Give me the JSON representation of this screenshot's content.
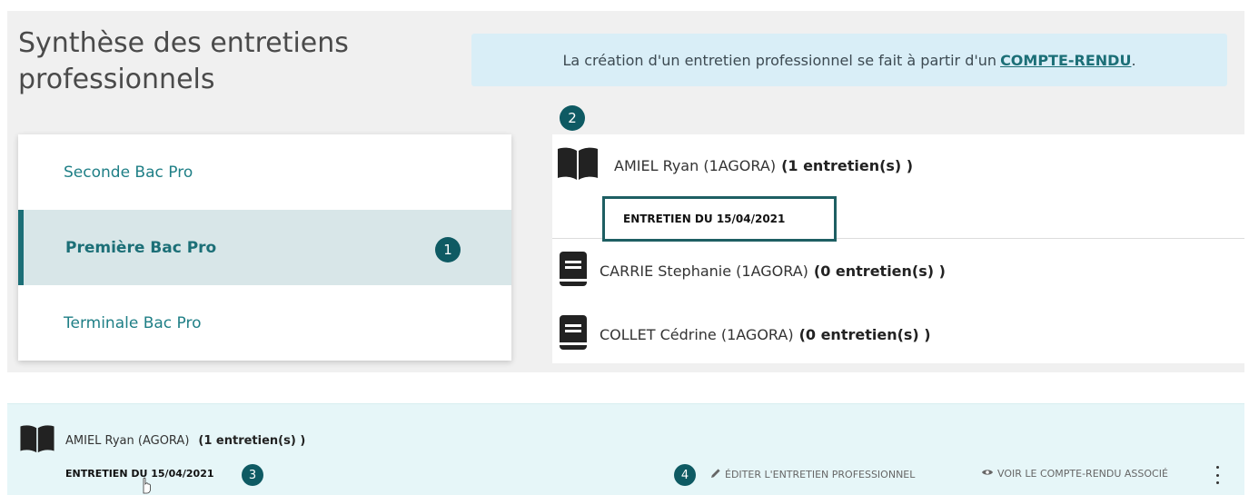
{
  "page": {
    "title_line1": "Synthèse des entretiens",
    "title_line2": "professionnels"
  },
  "banner": {
    "text": "La création d'un entretien professionnel se fait à partir d'un",
    "link": "COMPTE-RENDU",
    "suffix": "."
  },
  "levels": [
    {
      "label": "Seconde Bac Pro",
      "active": false
    },
    {
      "label": "Première Bac Pro",
      "active": true
    },
    {
      "label": "Terminale Bac Pro",
      "active": false
    }
  ],
  "students": [
    {
      "name": "AMIEL Ryan (1AGORA)",
      "count": "(1 entretien(s) )",
      "icon": "open-book-icon"
    },
    {
      "name": "CARRIE Stephanie (1AGORA)",
      "count": "(0 entretien(s) )",
      "icon": "closed-book-icon"
    },
    {
      "name": "COLLET Cédrine (1AGORA)",
      "count": "(0 entretien(s) )",
      "icon": "closed-book-icon"
    }
  ],
  "selected_entretien": "ENTRETIEN DU 15/04/2021",
  "detail": {
    "student_name": "AMIEL Ryan (AGORA)",
    "count": "(1 entretien(s) )",
    "entretien": "ENTRETIEN DU 15/04/2021",
    "edit_label": "ÉDITER L'ENTRETIEN PROFESSIONNEL",
    "view_label": "VOIR LE COMPTE-RENDU ASSOCIÉ"
  },
  "badges": {
    "b1": "1",
    "b2": "2",
    "b3": "3",
    "b4": "4"
  },
  "colors": {
    "accent": "#1c6f77",
    "badge": "#0e5a63",
    "banner_bg": "#d9eef7",
    "active_bg": "#d8e6e8"
  }
}
